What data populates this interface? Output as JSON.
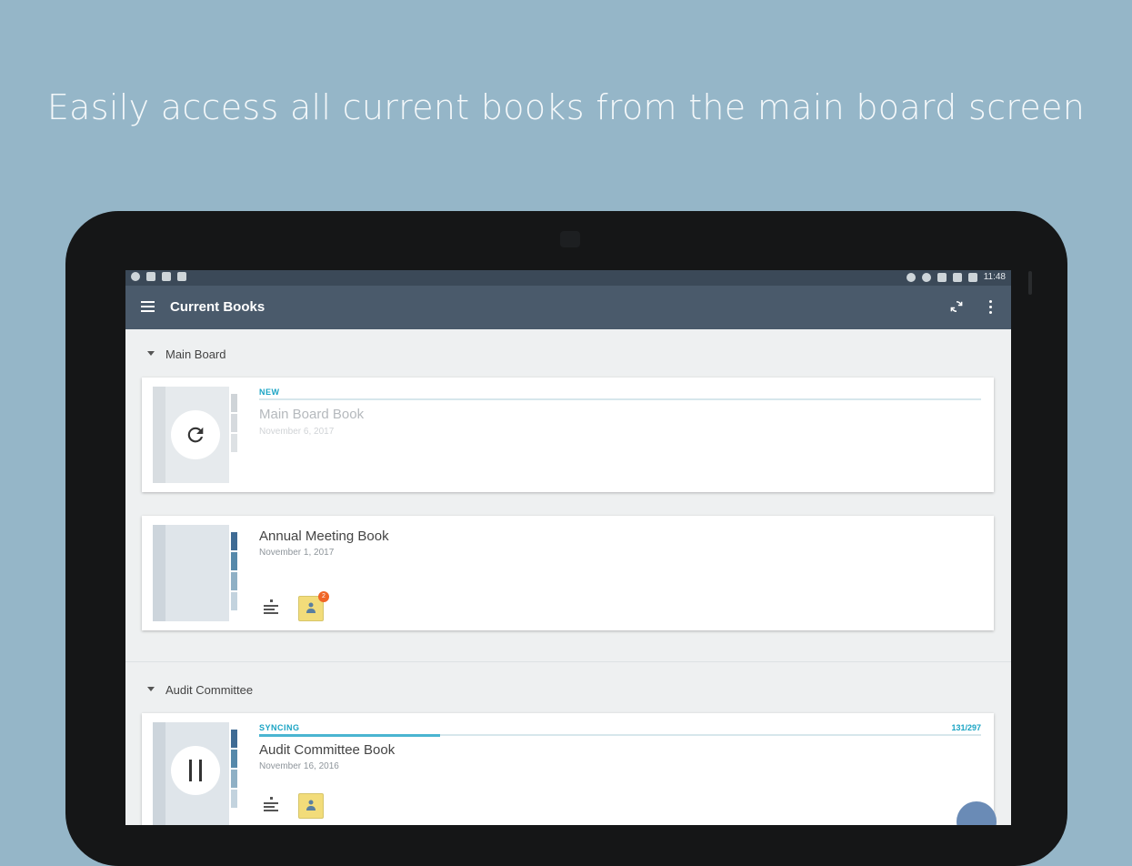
{
  "tagline": "Easily access all current books from the main board screen",
  "status_bar": {
    "time": "11:48"
  },
  "app_bar": {
    "title": "Current Books"
  },
  "sections": [
    {
      "name": "Main Board",
      "books": [
        {
          "status": "NEW",
          "title": "Main Board Book",
          "date": "November 6, 2017",
          "cover_action": "refresh-icon"
        },
        {
          "status": "",
          "title": "Annual Meeting Book",
          "date": "November 1, 2017",
          "annotation_badge": "2"
        }
      ]
    },
    {
      "name": "Audit Committee",
      "books": [
        {
          "status": "SYNCING",
          "title": "Audit Committee Book",
          "date": "November 16, 2016",
          "progress_count": "131/297",
          "progress": 0.25,
          "cover_action": "pause-icon"
        }
      ]
    }
  ],
  "colors": {
    "background": "#95b6c8",
    "app_bar": "#4a5a6b",
    "accent": "#1aa4c4",
    "badge": "#f06526"
  }
}
